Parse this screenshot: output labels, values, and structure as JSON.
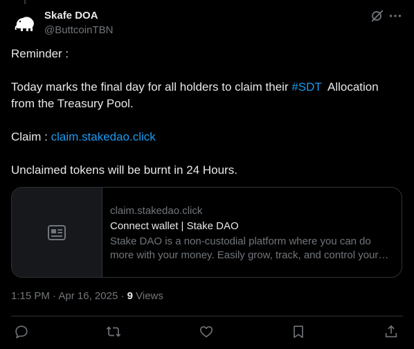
{
  "author": {
    "display_name": "Skafe DOA",
    "handle": "@ButtcoinTBN"
  },
  "post": {
    "line1": "Reminder :",
    "line2_pre": "Today marks the final day for all holders to claim their ",
    "line2_hashtag": "#SDT",
    "line2_post": "  Allocation from the Treasury Pool.",
    "claim_label": "Claim : ",
    "claim_link": "claim.stakedao.click",
    "line4": "Unclaimed tokens will be burnt in 24 Hours."
  },
  "card": {
    "domain": "claim.stakedao.click",
    "title": "Connect wallet | Stake DAO",
    "description": "Stake DAO is a non-custodial platform where you can do more with your money. Easily grow, track, and control your…"
  },
  "meta": {
    "time": "1:15 PM",
    "separator1": " · ",
    "date": "Apr 16, 2025",
    "separator2": " · ",
    "views_count": "9",
    "views_label": " Views"
  },
  "icons": {
    "avatar": "elephant-logo",
    "grok": "grok-icon",
    "more": "more-icon",
    "card_thumb": "article-icon",
    "reply": "reply-icon",
    "repost": "repost-icon",
    "like": "like-icon",
    "bookmark": "bookmark-icon",
    "share": "share-icon"
  },
  "colors": {
    "background": "#000000",
    "text": "#e7e9ea",
    "secondary": "#71767b",
    "link": "#1d9bf0",
    "border": "#2f3336"
  }
}
